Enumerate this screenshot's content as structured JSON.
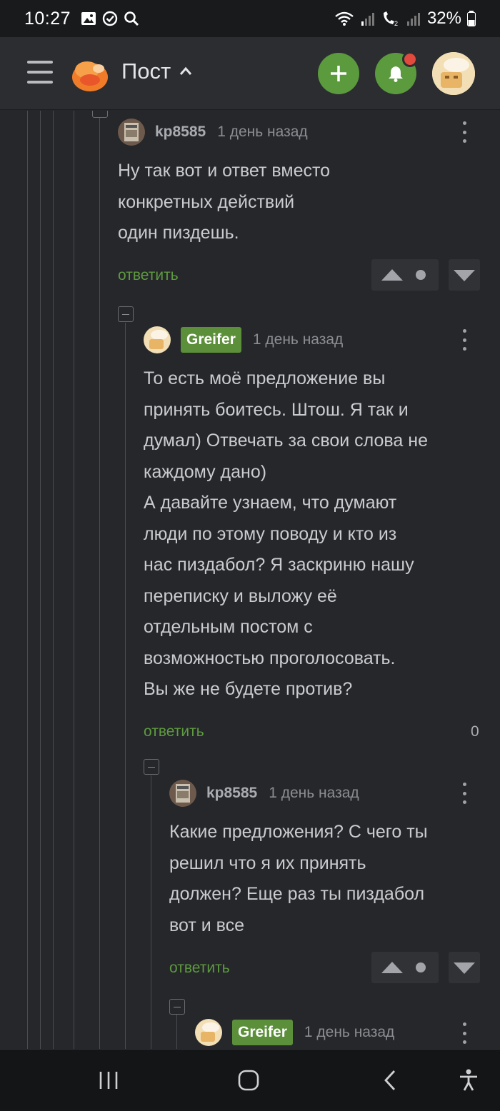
{
  "status_bar": {
    "time": "10:27",
    "battery": "32%",
    "icons": [
      "gallery-icon",
      "check-circle-icon",
      "search-icon",
      "wifi-icon",
      "signal-icon",
      "wifi-calling-icon",
      "battery-icon"
    ]
  },
  "header": {
    "title": "Пост",
    "icons": [
      "menu-icon",
      "pikabu-logo",
      "chevron-up-icon",
      "plus-icon",
      "bell-icon",
      "user-avatar"
    ]
  },
  "comments": [
    {
      "author": "kp8585",
      "author_badge": false,
      "time": "1 день назад",
      "text": "Ну так вот и ответ вместо\nконкретных действий\nодин пиздешь.",
      "reply_label": "ответить",
      "rating": null
    },
    {
      "author": "Greifer",
      "author_badge": true,
      "time": "1 день назад",
      "text": "То есть моё предложение вы\nпринять боитесь. Штош. Я так и\nдумал) Отвечать за свои слова не\nкаждому дано)\nА давайте узнаем, что думают\nлюди по этому поводу и кто из\nнас пиздабол? Я заскриню нашу\nпереписку и выложу её\nотдельным постом с\nвозможностью проголосовать.\nВы же не будете против?",
      "reply_label": "ответить",
      "rating": "0"
    },
    {
      "author": "kp8585",
      "author_badge": false,
      "time": "1 день назад",
      "text": "Какие предложения? С чего ты\nрешил что я их принять\nдолжен? Еще раз ты пиздабол\nвот и все",
      "reply_label": "ответить",
      "rating": null
    },
    {
      "author": "Greifer",
      "author_badge": true,
      "time": "1 день назад",
      "text": "",
      "reply_label": "",
      "rating": null
    }
  ],
  "colors": {
    "background": "#25272b",
    "accent_green": "#5b9a3d",
    "badge_green": "#5b8f3a",
    "notification_red": "#e14a3d",
    "text": "#c9cbcf",
    "muted": "#8b8d92"
  },
  "nav_bar": {
    "icons": [
      "recent-apps-icon",
      "home-icon",
      "back-icon",
      "accessibility-icon"
    ]
  }
}
